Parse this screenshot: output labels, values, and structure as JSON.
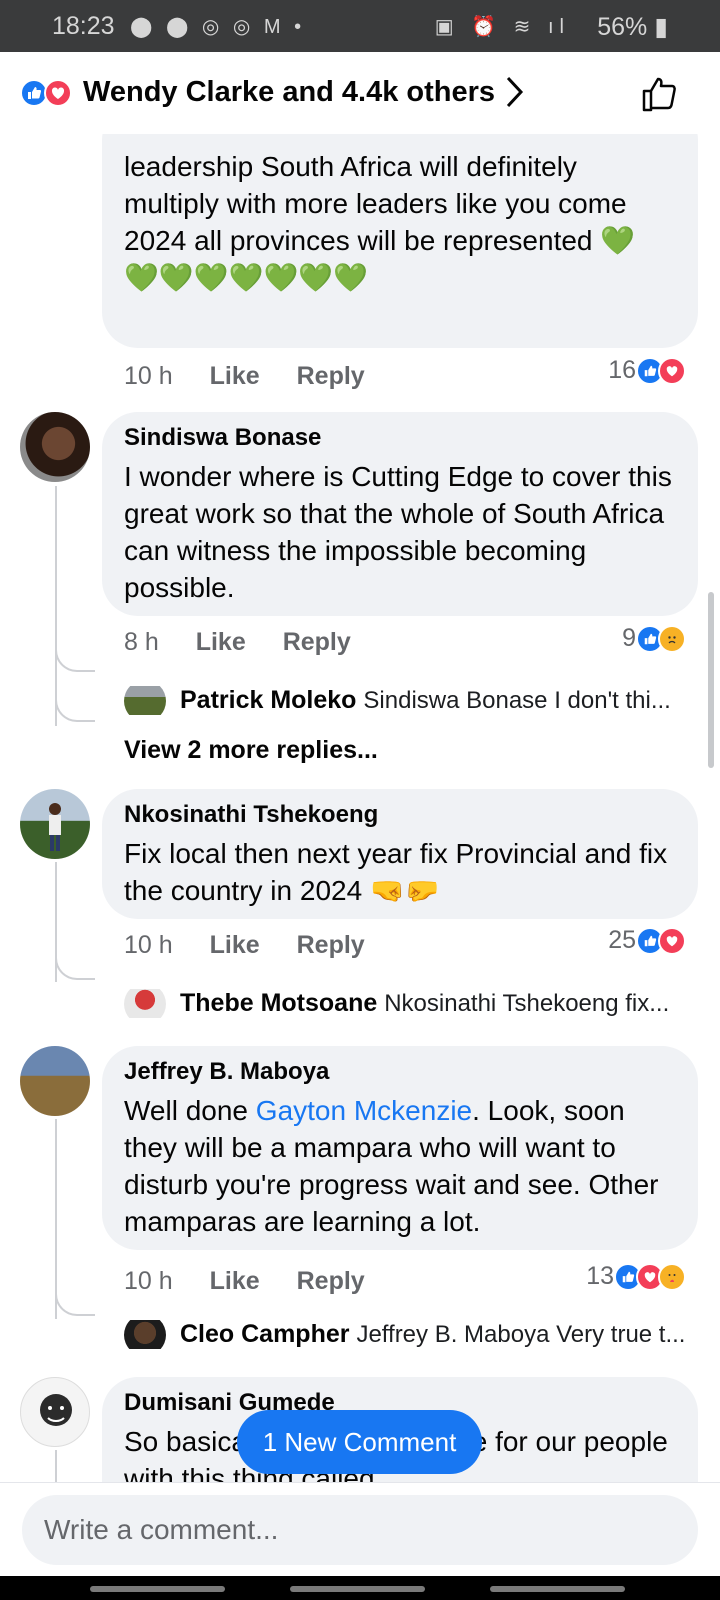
{
  "status_bar": {
    "time": "18:23",
    "left_icons": "⬤ ⬤ ◎ ◎ M •",
    "right_icons": "▣ ⏰ ≋ ıl",
    "battery": "56%"
  },
  "header": {
    "title": "Wendy Clarke and 4.4k others"
  },
  "comments": [
    {
      "partial_text_line1": "leadership South Africa will definitely",
      "partial_text_line2": "multiply with more leaders like you come",
      "partial_text_line3": "2024 all provinces will be represented 💚",
      "partial_text_line4": "💚💚💚💚💚💚💚",
      "time": "10 h",
      "like": "Like",
      "reply": "Reply",
      "count": "16"
    },
    {
      "author": "Sindiswa Bonase",
      "text": "I wonder where is Cutting Edge to cover this great work so that the whole of South Africa can witness the impossible becoming possible.",
      "time": "8 h",
      "like": "Like",
      "reply": "Reply",
      "count": "9",
      "reply_preview_name": "Patrick Moleko",
      "reply_preview_text": "Sindiswa Bonase I don't thi...",
      "view_more": "View 2 more replies..."
    },
    {
      "author": "Nkosinathi Tshekoeng",
      "text": "Fix local then next year fix Provincial and fix the country in 2024 🤜🤛",
      "time": "10 h",
      "like": "Like",
      "reply": "Reply",
      "count": "25",
      "reply_preview_name": "Thebe Motsoane",
      "reply_preview_text": "Nkosinathi Tshekoeng fix..."
    },
    {
      "author": "Jeffrey B. Maboya",
      "text_before": "Well done ",
      "mention": "Gayton Mckenzie",
      "text_after": ". Look, soon they will be a mampara who will want to disturb you're progress wait and see. Other mamparas are learning a lot.",
      "time": "10 h",
      "like": "Like",
      "reply": "Reply",
      "count": "13",
      "reply_preview_name": "Cleo Campher",
      "reply_preview_text": "Jeffrey B. Maboya Very true t..."
    },
    {
      "author": "Dumisani Gumede",
      "text": "So basically there's better life for our people with this thing called"
    }
  ],
  "new_comment_button": "1 New Comment",
  "composer": {
    "placeholder": "Write a comment..."
  },
  "colors": {
    "accent": "#1877f2",
    "love": "#f33e58",
    "bubble": "#f0f2f5",
    "meta": "#65676b"
  }
}
